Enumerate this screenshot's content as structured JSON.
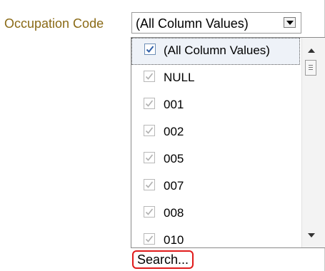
{
  "filter": {
    "label": "Occupation Code",
    "selected_value": "(All Column Values)"
  },
  "dropdown": {
    "items": [
      {
        "label": "(All Column Values)",
        "checked": true,
        "selected": true
      },
      {
        "label": "NULL",
        "checked": true,
        "selected": false
      },
      {
        "label": "001",
        "checked": true,
        "selected": false
      },
      {
        "label": "002",
        "checked": true,
        "selected": false
      },
      {
        "label": "005",
        "checked": true,
        "selected": false
      },
      {
        "label": "007",
        "checked": true,
        "selected": false
      },
      {
        "label": "008",
        "checked": true,
        "selected": false
      },
      {
        "label": "010",
        "checked": true,
        "selected": false
      }
    ],
    "search_label": "Search..."
  },
  "colors": {
    "label_text": "#8a6a16",
    "search_highlight": "#e01b1b",
    "check_active": "#2f5fa8",
    "check_inactive": "#b0b0b0"
  }
}
